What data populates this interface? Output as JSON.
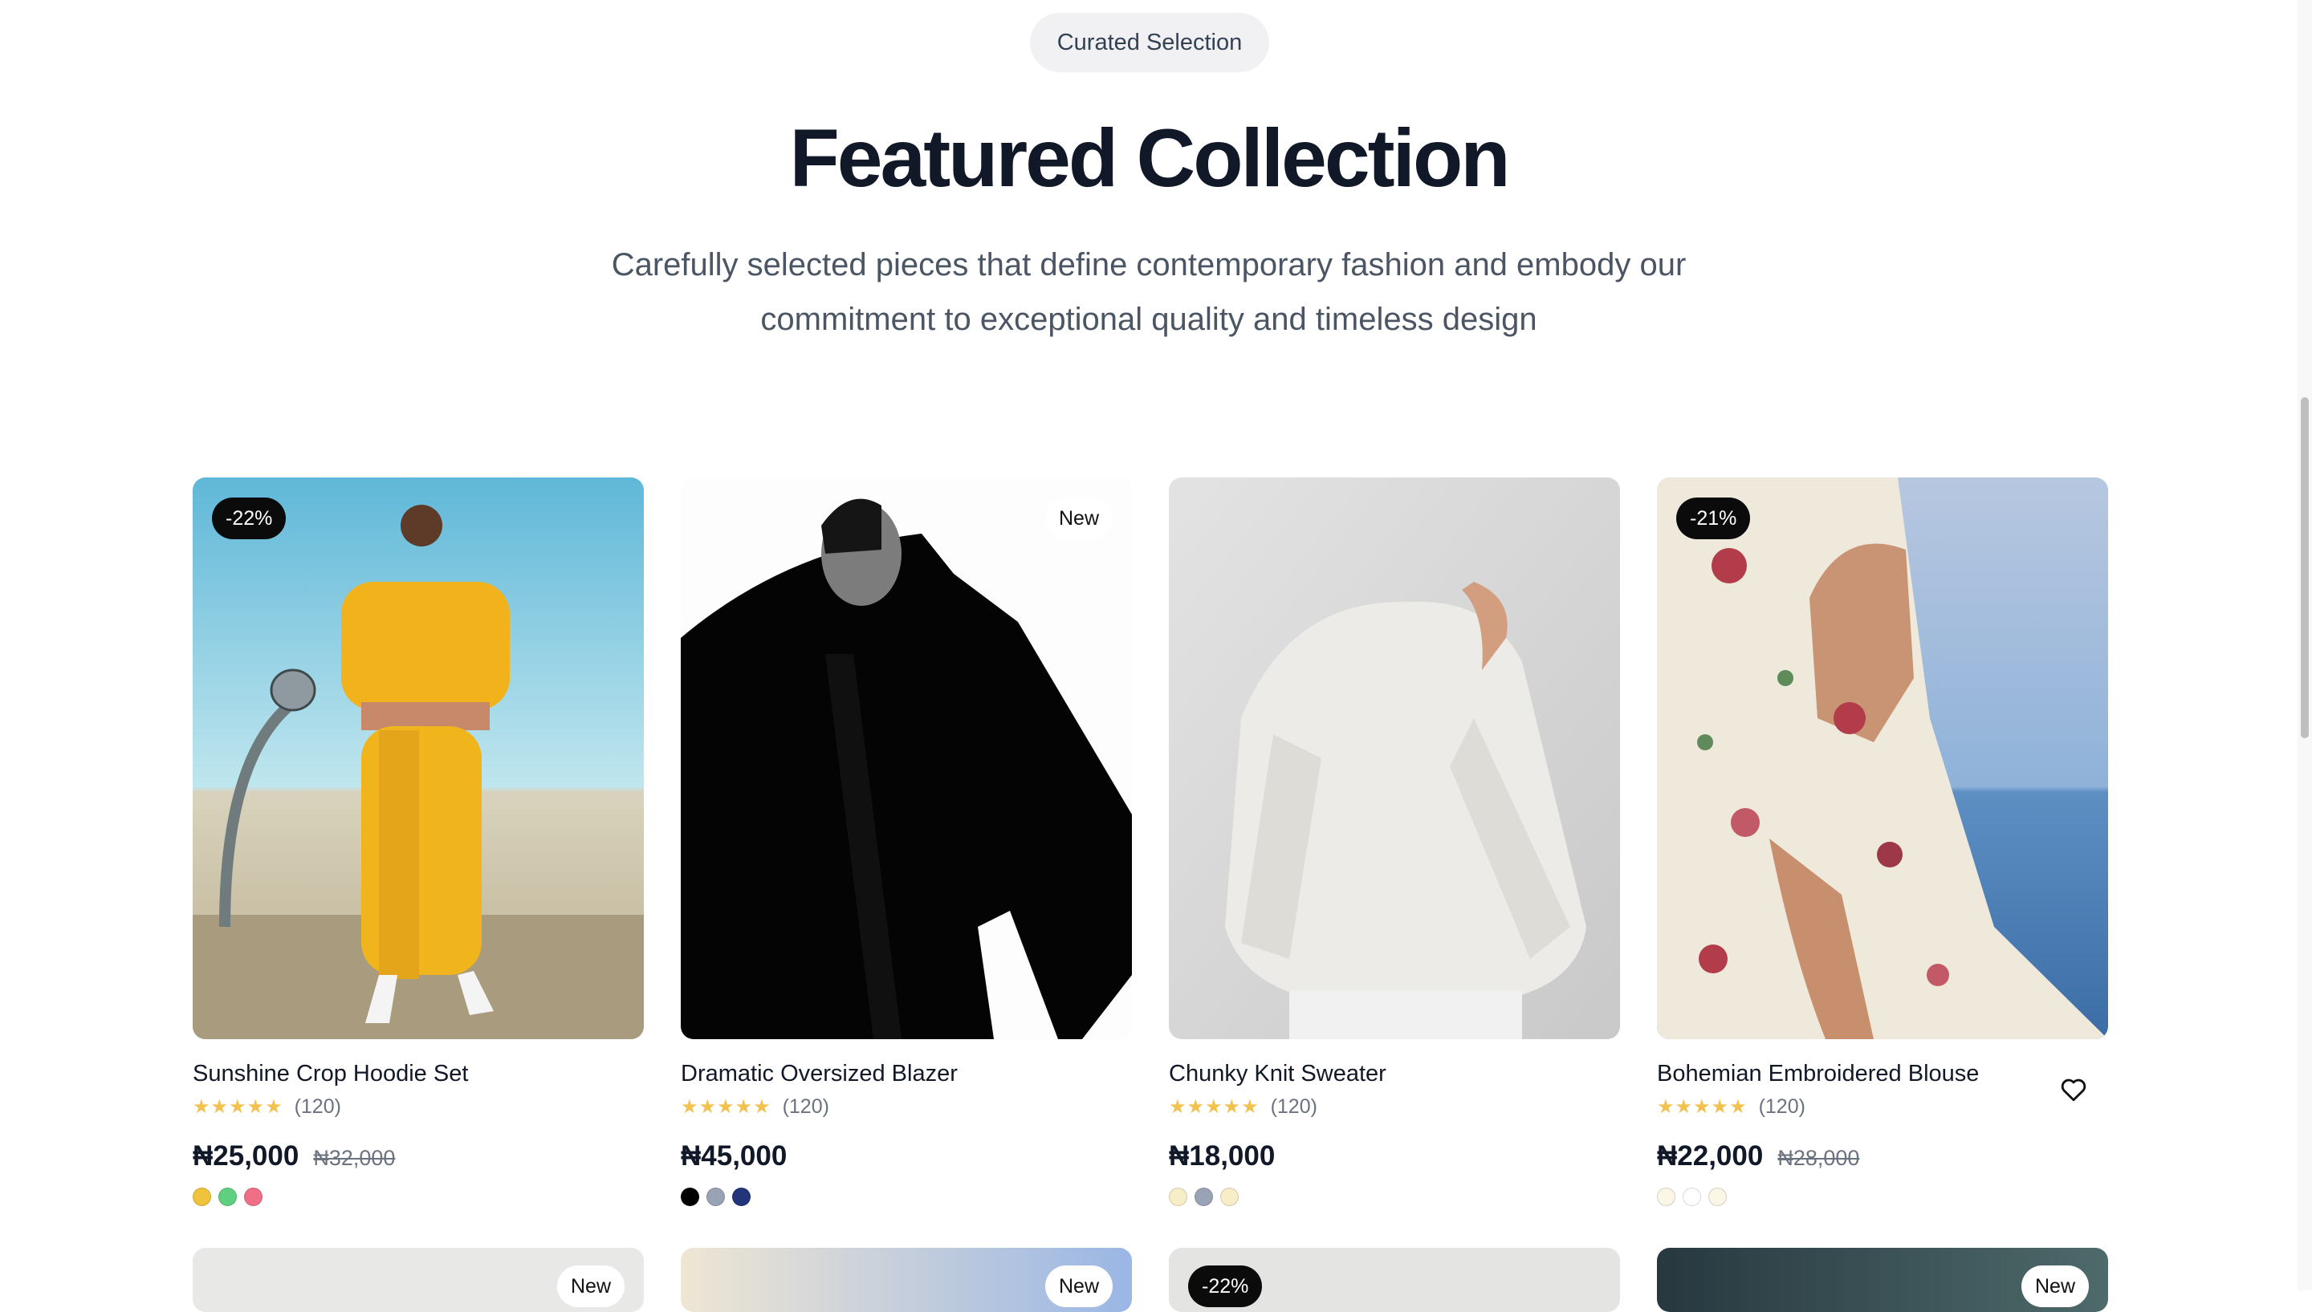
{
  "header": {
    "eyebrow": "Curated Selection",
    "title": "Featured Collection",
    "subtitle_line1": "Carefully selected pieces that define contemporary fashion and embody our",
    "subtitle_line2": "commitment to exceptional quality and timeless design"
  },
  "products": [
    {
      "name": "Sunshine Crop Hoodie Set",
      "stars": "★★★★★",
      "reviews": "(120)",
      "price": "₦25,000",
      "old_price": "₦32,000",
      "badge": "-22%",
      "swatches": [
        "#f0c33c",
        "#5fcf80",
        "#ef6f86"
      ]
    },
    {
      "name": "Dramatic Oversized Blazer",
      "stars": "★★★★★",
      "reviews": "(120)",
      "price": "₦45,000",
      "badge": "New",
      "swatches": [
        "#000000",
        "#9aa3b5",
        "#22357a"
      ]
    },
    {
      "name": "Chunky Knit Sweater",
      "stars": "★★★★★",
      "reviews": "(120)",
      "price": "₦18,000",
      "swatches": [
        "#f7edc7",
        "#9aa3b5",
        "#f7edc7"
      ]
    },
    {
      "name": "Bohemian Embroidered Blouse",
      "stars": "★★★★★",
      "reviews": "(120)",
      "price": "₦22,000",
      "old_price": "₦28,000",
      "badge": "-21%",
      "swatches": [
        "#fbf6e6",
        "#ffffff",
        "#fbf6e6"
      ],
      "icon": "heart-icon"
    }
  ],
  "next_row": [
    {
      "badge": "New"
    },
    {
      "badge": "New"
    },
    {
      "badge": "-22%"
    },
    {
      "badge": "New"
    }
  ]
}
